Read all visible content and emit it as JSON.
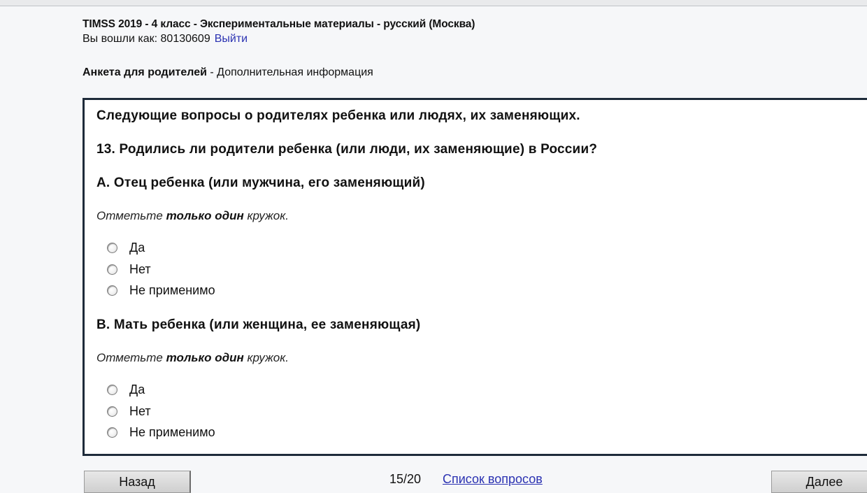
{
  "header": {
    "title": "TIMSS 2019 - 4 класс - Экспериментальные материалы - русский (Москва)",
    "logged_in_as": "Вы вошли как: 80130609",
    "logout_label": "Выйти"
  },
  "section": {
    "name": "Анкета для родителей",
    "separator": " - ",
    "subtitle": "Дополнительная информация"
  },
  "question": {
    "intro": "Следующие вопросы о родителях ребенка или людях, их заменяющих.",
    "number_text": "13. Родились ли родители ребенка (или люди, их заменяющие) в России?",
    "parts": [
      {
        "label": "A. Отец ребенка (или мужчина, его заменяющий)",
        "instruction_pre": "Отметьте ",
        "instruction_bold": "только один",
        "instruction_post": " кружок.",
        "options": [
          "Да",
          "Нет",
          "Не применимо"
        ]
      },
      {
        "label": "B. Мать ребенка (или женщина, ее заменяющая)",
        "instruction_pre": "Отметьте ",
        "instruction_bold": "только один",
        "instruction_post": " кружок.",
        "options": [
          "Да",
          "Нет",
          "Не применимо"
        ]
      }
    ]
  },
  "footer": {
    "back_label": "Назад",
    "page_counter": "15/20",
    "question_list_label": "Список вопросов",
    "next_label": "Далее"
  },
  "colors": {
    "link": "#2b32b2",
    "panel_border": "#1e2b3a",
    "background": "#f6f7f9"
  }
}
